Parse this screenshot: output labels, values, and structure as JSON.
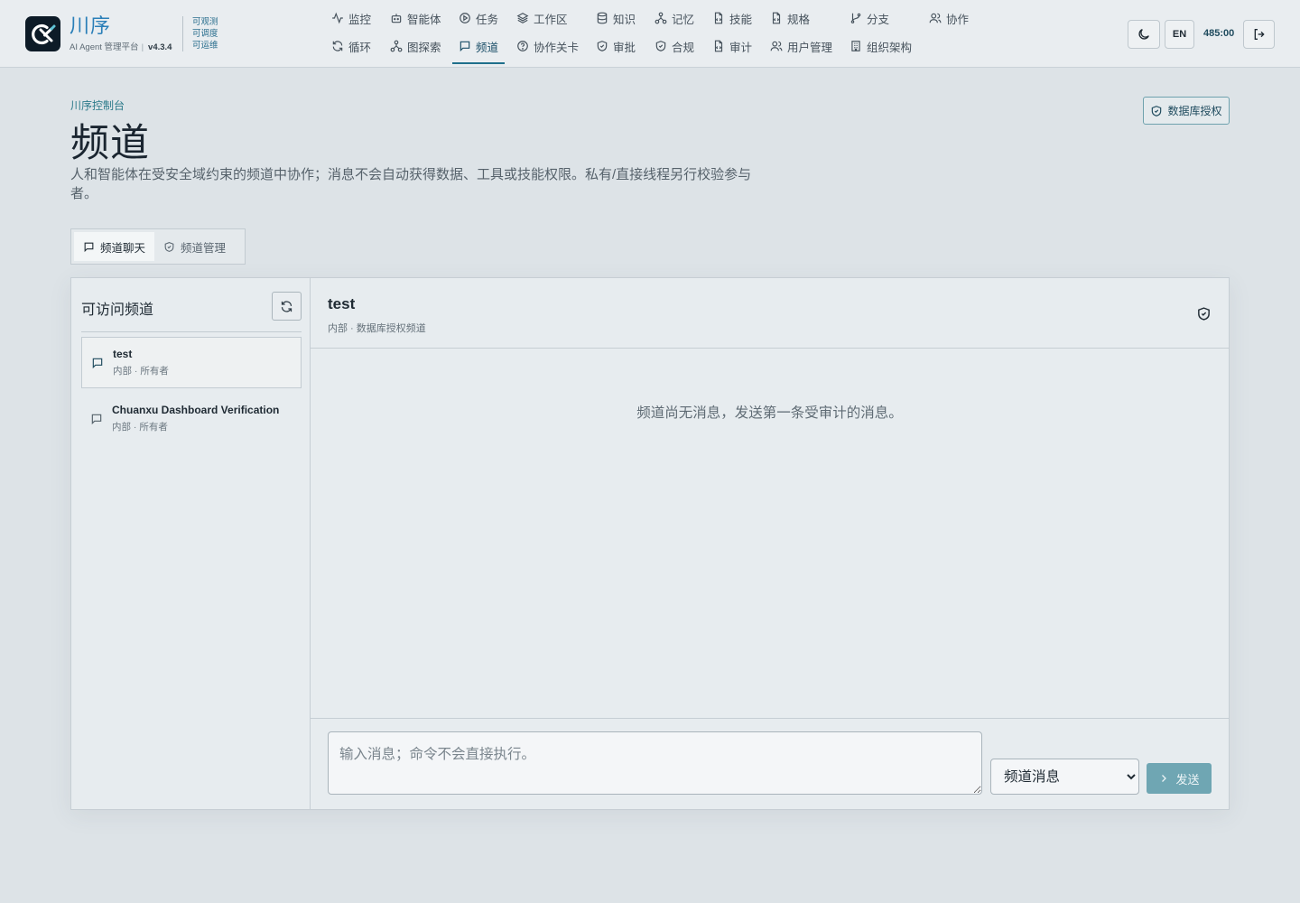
{
  "brand": {
    "name": "川序",
    "subtitle": "AI Agent 管理平台",
    "version": "v4.3.4",
    "taglines": [
      "可观测",
      "可调度",
      "可运维"
    ]
  },
  "nav": {
    "row1": [
      {
        "label": "监控",
        "icon": "activity-icon"
      },
      {
        "label": "智能体",
        "icon": "bot-icon"
      },
      {
        "label": "任务",
        "icon": "play-circle-icon"
      },
      {
        "label": "工作区",
        "icon": "layers-icon"
      },
      {
        "label": "知识",
        "icon": "database-icon"
      },
      {
        "label": "记忆",
        "icon": "network-icon"
      },
      {
        "label": "技能",
        "icon": "file-code-icon"
      },
      {
        "label": "规格",
        "icon": "file-code-icon"
      },
      {
        "label": "分支",
        "icon": "git-branch-icon"
      },
      {
        "label": "协作",
        "icon": "users-icon"
      }
    ],
    "row2": [
      {
        "label": "循环",
        "icon": "refresh-icon"
      },
      {
        "label": "图探索",
        "icon": "network-icon"
      },
      {
        "label": "频道",
        "icon": "message-icon",
        "active": true
      },
      {
        "label": "协作关卡",
        "icon": "help-circle-icon"
      },
      {
        "label": "审批",
        "icon": "shield-check-icon"
      },
      {
        "label": "合规",
        "icon": "shield-check-icon"
      },
      {
        "label": "审计",
        "icon": "file-code-icon"
      },
      {
        "label": "用户管理",
        "icon": "users-icon"
      },
      {
        "label": "组织架构",
        "icon": "building-icon"
      }
    ]
  },
  "topbar": {
    "lang_label": "EN",
    "timer": "485:00"
  },
  "header": {
    "breadcrumb": "川序控制台",
    "title": "频道",
    "description": "人和智能体在受安全域约束的频道中协作；消息不会自动获得数据、工具或技能权限。私有/直接线程另行校验参与者。",
    "db_auth_label": "数据库授权"
  },
  "tabs": [
    {
      "label": "频道聊天",
      "active": true
    },
    {
      "label": "频道管理",
      "active": false
    }
  ],
  "sidebar": {
    "title": "可访问频道",
    "channels": [
      {
        "name": "test",
        "meta": "内部 · 所有者",
        "active": true
      },
      {
        "name": "Chuanxu Dashboard Verification",
        "meta": "内部 · 所有者",
        "active": false
      }
    ]
  },
  "chat": {
    "title": "test",
    "subtitle": "内部 · 数据库授权频道",
    "empty_message": "频道尚无消息，发送第一条受审计的消息。"
  },
  "composer": {
    "placeholder": "输入消息；命令不会直接执行。",
    "type_selected": "频道消息",
    "send_label": "发送"
  },
  "colors": {
    "accent": "#1f6f8b",
    "brand_blue": "#2a7fb8",
    "send_button": "#6fa6b3"
  }
}
